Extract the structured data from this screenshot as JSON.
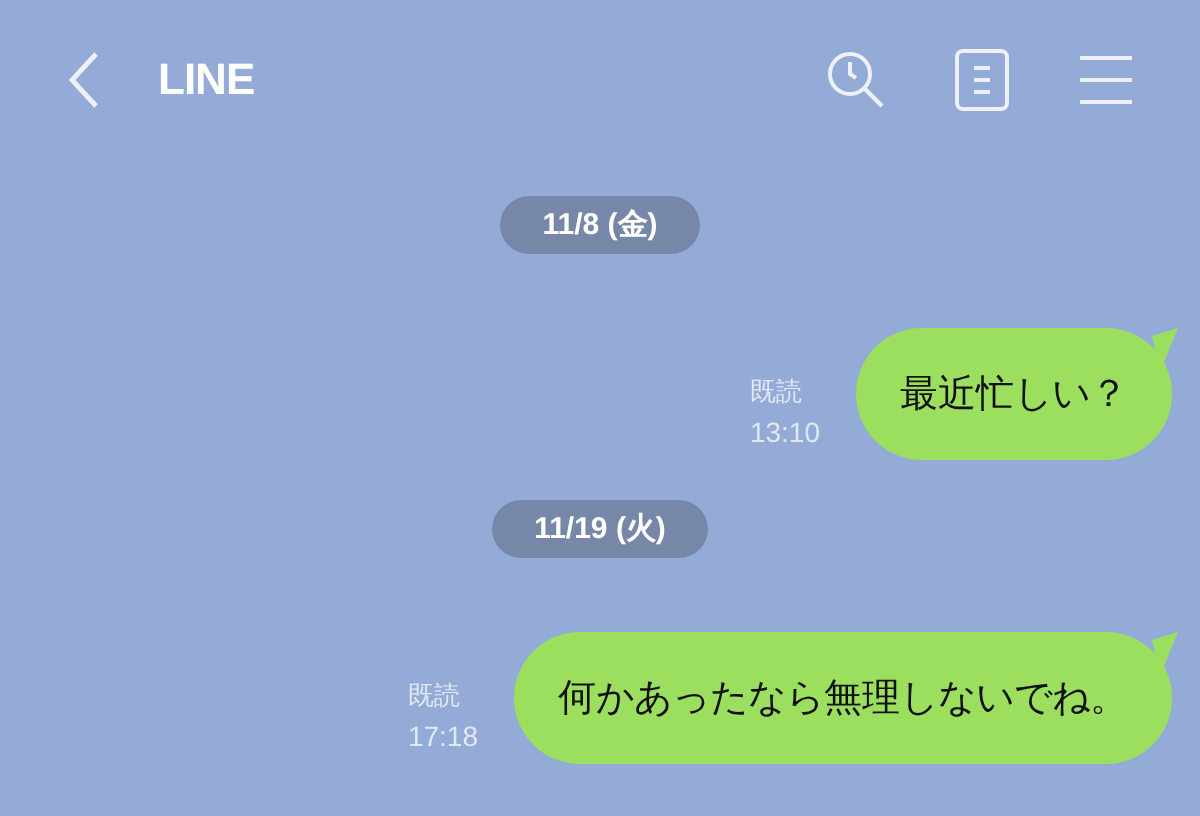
{
  "header": {
    "title": "LINE"
  },
  "chat": [
    {
      "kind": "date",
      "text": "11/8 (金)"
    },
    {
      "kind": "message",
      "read": "既読",
      "time": "13:10",
      "text": "最近忙しい？"
    },
    {
      "kind": "date",
      "text": "11/19 (火)"
    },
    {
      "kind": "message",
      "read": "既読",
      "time": "17:18",
      "text": "何かあったなら無理しないでね。"
    }
  ]
}
